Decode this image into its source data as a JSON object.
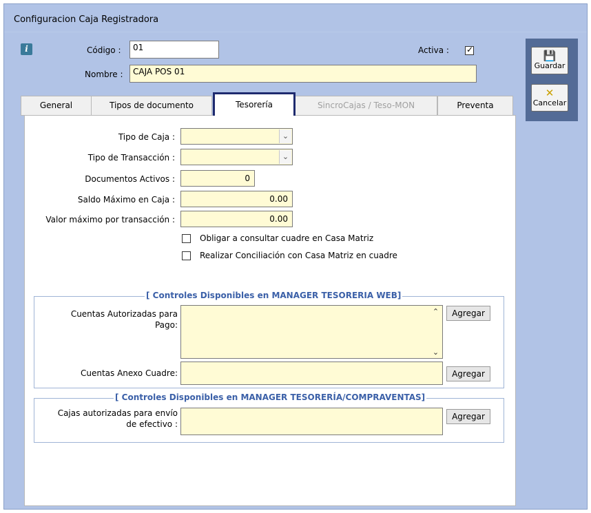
{
  "window": {
    "title": "Configuracion  Caja  Registradora"
  },
  "header": {
    "codigo_label": "Código :",
    "codigo_value": "01",
    "activa_label": "Activa :",
    "activa_checked": "✓",
    "nombre_label": "Nombre :",
    "nombre_value": "CAJA POS 01"
  },
  "sidebar": {
    "save_label": "Guardar",
    "cancel_label": "Cancelar"
  },
  "tabs": [
    {
      "label": "General"
    },
    {
      "label": "Tipos de documento"
    },
    {
      "label": "Tesorería",
      "active": true
    },
    {
      "label": "SincroCajas / Teso-MON",
      "disabled": true
    },
    {
      "label": "Preventa"
    }
  ],
  "form": {
    "tipo_caja_label": "Tipo de Caja :",
    "tipo_caja_value": "",
    "tipo_transaccion_label": "Tipo de Transacción :",
    "tipo_transaccion_value": "",
    "documentos_activos_label": "Documentos  Activos :",
    "documentos_activos_value": "0",
    "saldo_maximo_label": "Saldo Máximo en Caja :",
    "saldo_maximo_value": "0.00",
    "valor_maximo_label": "Valor máximo por transacción :",
    "valor_maximo_value": "0.00",
    "obligar_label": "Obligar a consultar cuadre en Casa Matriz",
    "conciliacion_label": "Realizar Conciliación con Casa Matriz en cuadre"
  },
  "group_web": {
    "title": "[ Controles Disponibles en MANAGER TESORERIA WEB]",
    "cuentas_pago_label_1": "Cuentas Autorizadas para",
    "cuentas_pago_label_2": "Pago:",
    "cuentas_anexo_label": "Cuentas Anexo Cuadre:",
    "agregar": "Agregar"
  },
  "group_compraventas": {
    "title": "[ Controles Disponibles en MANAGER TESORERÍA/COMPRAVENTAS]",
    "cajas_label_1": "Cajas autorizadas para envío",
    "cajas_label_2": "de efectivo :",
    "agregar": "Agregar"
  },
  "colors": {
    "window_bg": "#b1c3e6",
    "field_bg": "#fffbd5",
    "group_title": "#3b60a8",
    "sidebar_bg": "#536b96",
    "active_tab_border": "#1e2a6e"
  },
  "icons": [
    "info-icon",
    "save-icon",
    "cancel-icon",
    "chevron-down-icon",
    "scroll-up-icon",
    "scroll-down-icon",
    "checkmark-icon"
  ]
}
